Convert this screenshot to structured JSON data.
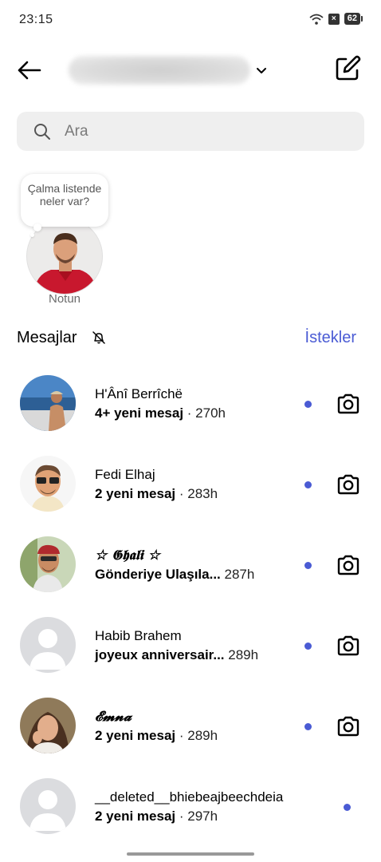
{
  "status_bar": {
    "time": "23:15",
    "battery": "62"
  },
  "header": {
    "account_name": "",
    "back_icon": "arrow-left-icon",
    "compose_icon": "compose-icon"
  },
  "search": {
    "placeholder": "Ara"
  },
  "note": {
    "bubble_text": "Çalma listende neler var?",
    "label": "Notun"
  },
  "section": {
    "title": "Mesajlar",
    "requests_label": "İstekler"
  },
  "messages": [
    {
      "name": "H'Ânî Berrîchë",
      "preview": "4+ yeni mesaj",
      "separator": " · ",
      "time": "270h",
      "unread": true,
      "camera": true
    },
    {
      "name": "Fedi Elhaj",
      "preview": "2 yeni mesaj",
      "separator": " · ",
      "time": "283h",
      "unread": true,
      "camera": true
    },
    {
      "name": "☆ 𝕲𝖍𝖆𝖑𝖎 ☆",
      "preview": "Gönderiye Ulaşıla...",
      "separator": "   ",
      "time": "287h",
      "unread": true,
      "camera": true
    },
    {
      "name": "Habib Brahem",
      "preview": "joyeux anniversair...",
      "separator": "  ",
      "time": "289h",
      "unread": true,
      "camera": true
    },
    {
      "name": "𝓔𝓶𝓷𝓪",
      "preview": "2 yeni mesaj",
      "separator": " · ",
      "time": "289h",
      "unread": true,
      "camera": true
    },
    {
      "name": "__deleted__bhiebeajbeechdeia",
      "preview": "2 yeni mesaj",
      "separator": " · ",
      "time": "297h",
      "unread": true,
      "camera": false
    }
  ],
  "colors": {
    "accent": "#4a5bd4",
    "search_bg": "#efefef"
  }
}
